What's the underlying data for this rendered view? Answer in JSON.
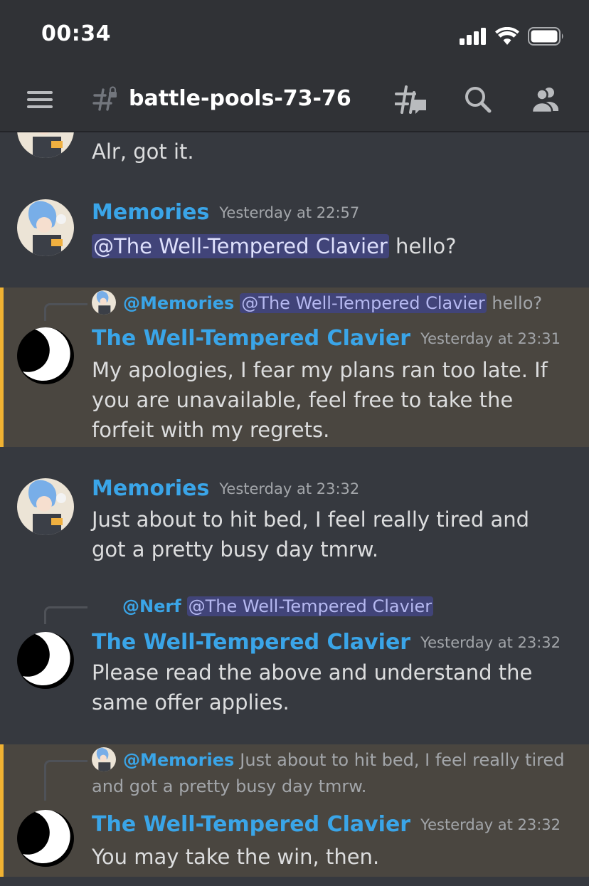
{
  "status": {
    "time": "00:34"
  },
  "header": {
    "channel": "battle-pools-73-76"
  },
  "messages": [
    {
      "text": "Alr, got it."
    },
    {
      "author": "Memories",
      "time": "Yesterday at 22:57",
      "mention": "@The Well-Tempered Clavier",
      "text": " hello?"
    },
    {
      "reply": {
        "author": "@Memories",
        "mention": "@The Well-Tempered Clavier",
        "text": " hello?"
      },
      "author": "The Well-Tempered Clavier",
      "time": "Yesterday at 23:31",
      "text": "My apologies, I fear my plans ran too late. If you are unavailable, feel free to take the forfeit with my regrets."
    },
    {
      "author": "Memories",
      "time": "Yesterday at 23:32",
      "text": "Just about to hit bed, I feel really tired and got a pretty busy day tmrw."
    },
    {
      "reply": {
        "author": "@Nerf",
        "mention": "@The Well-Tempered Clavier"
      },
      "author": "The Well-Tempered Clavier",
      "time": "Yesterday at 23:32",
      "text": "Please read the above and understand the same offer applies."
    },
    {
      "reply": {
        "author": "@Memories",
        "text": "Just about to hit bed, I feel really tired and got a pretty busy day tmrw."
      },
      "author": "The Well-Tempered Clavier",
      "time": "Yesterday at 23:32",
      "text": "You may take the win, then."
    }
  ],
  "icons": {
    "menu": "hamburger-icon",
    "channel": "hashtag-locked-icon",
    "threads": "threads-icon",
    "search": "search-icon",
    "members": "members-icon"
  },
  "colors": {
    "accent": "#3aa5e8",
    "highlight": "#4a4640",
    "highlight_bar": "#f0b232",
    "mention_bg": "#414479"
  }
}
